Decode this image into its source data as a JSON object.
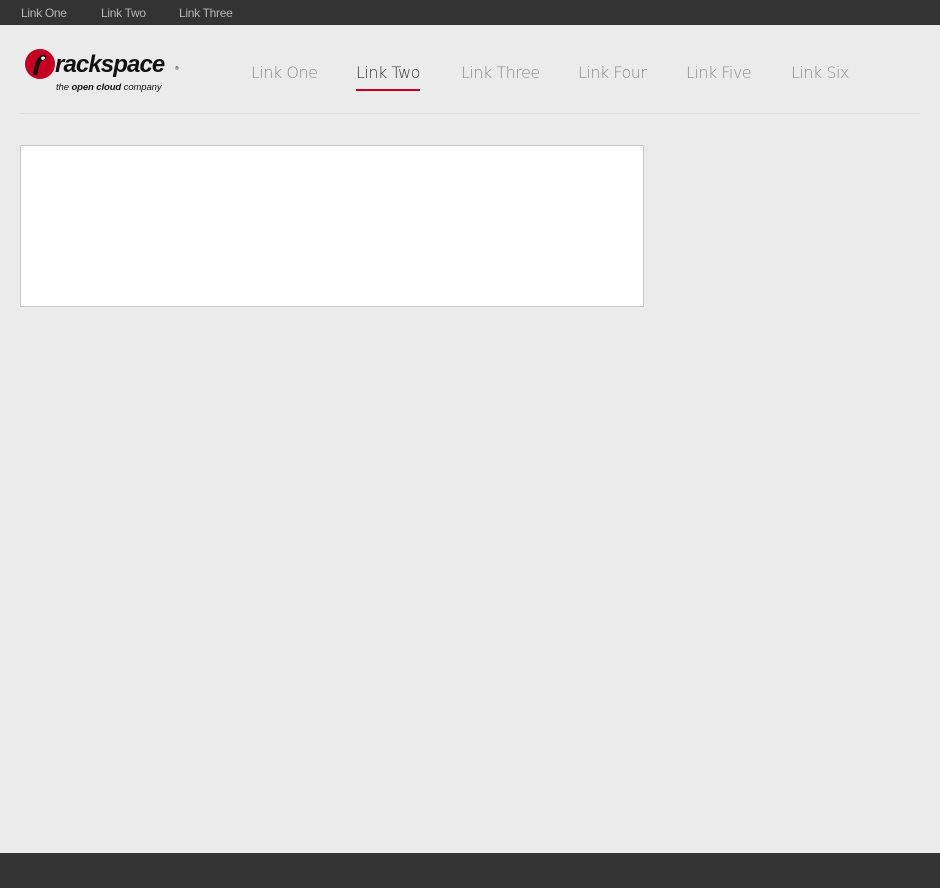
{
  "top_bar": {
    "links": [
      "Link One",
      "Link Two",
      "Link Three"
    ]
  },
  "logo": {
    "brand": "rackspace",
    "registered": "®",
    "tagline_prefix": "the ",
    "tagline_bold": "open cloud",
    "tagline_suffix": " company",
    "icon": "rackspace-logo-icon"
  },
  "main_nav": {
    "links": [
      "Link One",
      "Link Two",
      "Link Three",
      "Link Four",
      "Link Five",
      "Link Six"
    ],
    "active_label": "Link Two"
  },
  "colors": {
    "accent": "#c40022",
    "bar": "#333333",
    "background": "#ebebeb"
  }
}
